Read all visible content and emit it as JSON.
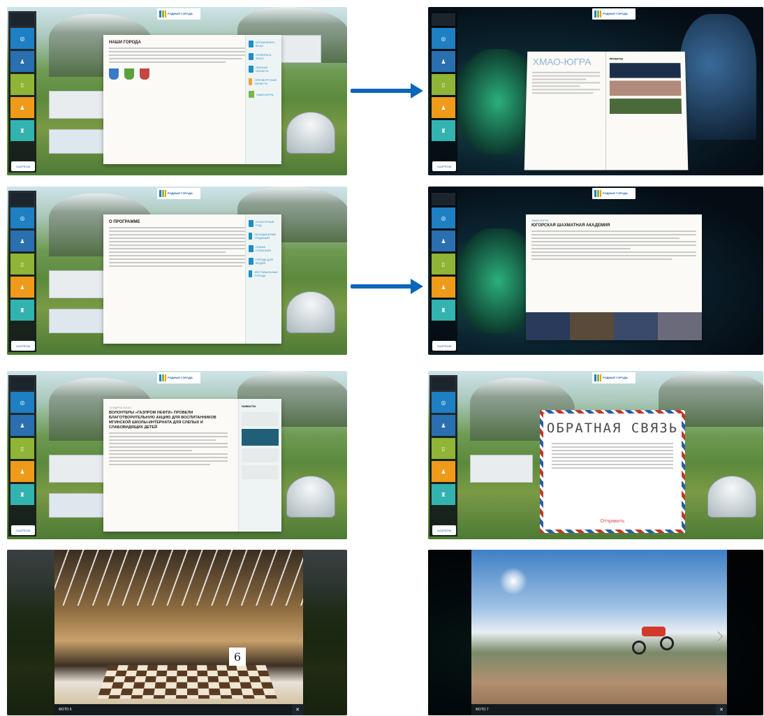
{
  "brand": {
    "name": "РОДНЫЕ ГОРОДА"
  },
  "panels": {
    "cities": {
      "title": "НАШИ ГОРОДА",
      "side_items": [
        "МУРАВЛЕНКО, ЯНАО",
        "НОЯБРЬСК, ЯНАО",
        "ОМСКАЯ ОБЛАСТЬ",
        "ОРЕНБУРГСКАЯ ОБЛАСТЬ",
        "ХМАО-ЮГРА"
      ]
    },
    "hmao": {
      "title": "ХМАО-ЮГРА",
      "section": "ПРОЕКТЫ"
    },
    "program": {
      "title": "О ПРОГРАММЕ",
      "side_items": [
        "КУЛЬТУРНЫЕ РОД",
        "ОБЪЕДИНЕНИЕ ТРАДИЦИЙ",
        "НОВАЯ ГАРМОНИЯ",
        "ГОРОДА ДЛЯ ЛЮДЕЙ",
        "ФЕСТИВАЛЬНЫЕ ГОРОДА"
      ]
    },
    "academy": {
      "breadcrumb": "ХМАО-ЮГРА",
      "title": "ЮГОРСКАЯ ШАХМАТНАЯ АКАДЕМИЯ"
    },
    "news": {
      "date": "17 МАРТА 2016 Г.",
      "title": "ВОЛОНТЕРЫ «ГАЗПРОМ НЕФТИ» ПРОВЕЛИ БЛАГОТВОРИТЕЛЬНУЮ АКЦИЮ ДЛЯ ВОСПИТАННИКОВ МГИНСКОЙ ШКОЛЫ-ИНТЕРНАТА ДЛЯ СЛЕПЫХ И СЛАБОВИДЯЩИХ ДЕТЕЙ",
      "sidebar_title": "НОВОСТИ"
    },
    "feedback": {
      "title": "ОБРАТНАЯ СВЯЗЬ",
      "send": "Отправить"
    },
    "photo1": {
      "caption": "ФОТО 6"
    },
    "photo2": {
      "caption": "ФОТО 7"
    }
  },
  "colors": {
    "arrow": "#0a66b8",
    "tile_blue": "#1f7fc3",
    "tile_green": "#8fb436",
    "tile_orange": "#f09a1a",
    "tile_teal": "#33b3b0"
  }
}
